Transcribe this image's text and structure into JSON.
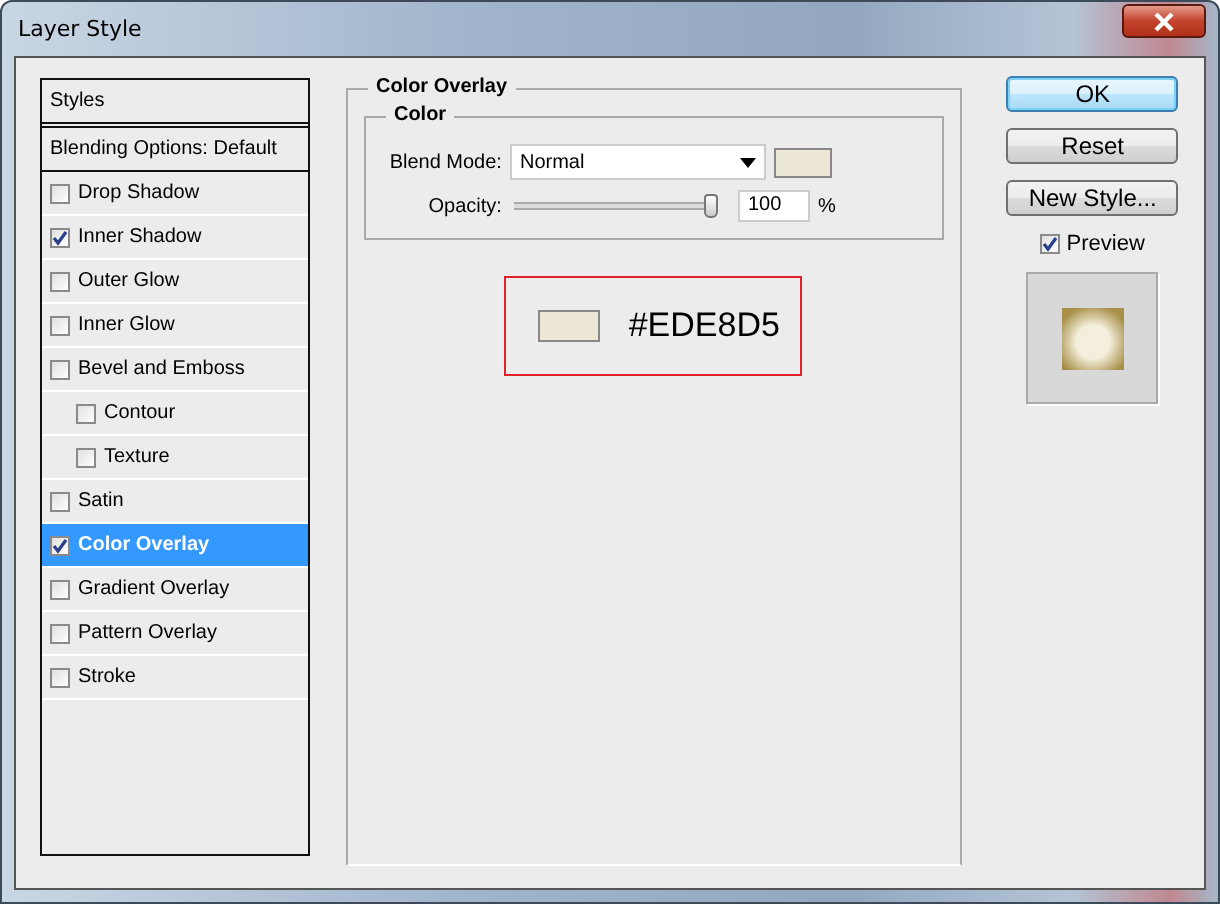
{
  "window": {
    "title": "Layer Style"
  },
  "sidebar": {
    "header": "Styles",
    "blending": "Blending Options: Default",
    "items": [
      {
        "label": "Drop Shadow",
        "checked": false,
        "selected": false,
        "indented": false
      },
      {
        "label": "Inner Shadow",
        "checked": true,
        "selected": false,
        "indented": false
      },
      {
        "label": "Outer Glow",
        "checked": false,
        "selected": false,
        "indented": false
      },
      {
        "label": "Inner Glow",
        "checked": false,
        "selected": false,
        "indented": false
      },
      {
        "label": "Bevel and Emboss",
        "checked": false,
        "selected": false,
        "indented": false
      },
      {
        "label": "Contour",
        "checked": false,
        "selected": false,
        "indented": true
      },
      {
        "label": "Texture",
        "checked": false,
        "selected": false,
        "indented": true
      },
      {
        "label": "Satin",
        "checked": false,
        "selected": false,
        "indented": false
      },
      {
        "label": "Color Overlay",
        "checked": true,
        "selected": true,
        "indented": false
      },
      {
        "label": "Gradient Overlay",
        "checked": false,
        "selected": false,
        "indented": false
      },
      {
        "label": "Pattern Overlay",
        "checked": false,
        "selected": false,
        "indented": false
      },
      {
        "label": "Stroke",
        "checked": false,
        "selected": false,
        "indented": false
      }
    ]
  },
  "panel": {
    "title": "Color Overlay",
    "group": {
      "title": "Color",
      "blend_mode_label": "Blend Mode:",
      "blend_mode": "Normal",
      "color": "#ede8d5",
      "opacity_label": "Opacity:",
      "opacity": {
        "level": 1.0
      },
      "opacity_value": "100",
      "unit": "%"
    },
    "callout": {
      "color": "#ede8d5",
      "hex": "#EDE8D5"
    }
  },
  "buttons": [
    {
      "label": "OK",
      "default": true
    },
    {
      "label": "Reset",
      "default": false
    },
    {
      "label": "New Style...",
      "default": false
    }
  ],
  "preview": {
    "label": "Preview",
    "checked": true
  }
}
